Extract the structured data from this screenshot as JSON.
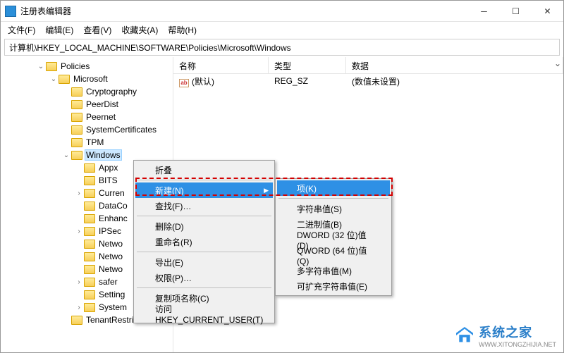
{
  "title": "注册表编辑器",
  "menus": {
    "file": "文件(F)",
    "edit": "编辑(E)",
    "view": "查看(V)",
    "fav": "收藏夹(A)",
    "help": "帮助(H)"
  },
  "address": "计算机\\HKEY_LOCAL_MACHINE\\SOFTWARE\\Policies\\Microsoft\\Windows",
  "cols": {
    "name": "名称",
    "type": "类型",
    "data": "数据"
  },
  "row": {
    "name": "(默认)",
    "type": "REG_SZ",
    "data": "(数值未设置)"
  },
  "tree": [
    {
      "indent": 50,
      "chev": "v",
      "label": "Policies"
    },
    {
      "indent": 68,
      "chev": "v",
      "label": "Microsoft"
    },
    {
      "indent": 86,
      "chev": "",
      "label": "Cryptography"
    },
    {
      "indent": 86,
      "chev": "",
      "label": "PeerDist"
    },
    {
      "indent": 86,
      "chev": "",
      "label": "Peernet"
    },
    {
      "indent": 86,
      "chev": "",
      "label": "SystemCertificates"
    },
    {
      "indent": 86,
      "chev": "",
      "label": "TPM"
    },
    {
      "indent": 86,
      "chev": "v",
      "label": "Windows",
      "selected": true
    },
    {
      "indent": 104,
      "chev": "",
      "label": "Appx"
    },
    {
      "indent": 104,
      "chev": "",
      "label": "BITS"
    },
    {
      "indent": 104,
      "chev": ">",
      "label": "Curren"
    },
    {
      "indent": 104,
      "chev": "",
      "label": "DataCo"
    },
    {
      "indent": 104,
      "chev": "",
      "label": "Enhanc"
    },
    {
      "indent": 104,
      "chev": ">",
      "label": "IPSec"
    },
    {
      "indent": 104,
      "chev": "",
      "label": "Netwo"
    },
    {
      "indent": 104,
      "chev": "",
      "label": "Netwo"
    },
    {
      "indent": 104,
      "chev": "",
      "label": "Netwo"
    },
    {
      "indent": 104,
      "chev": ">",
      "label": "safer"
    },
    {
      "indent": 104,
      "chev": "",
      "label": "Setting"
    },
    {
      "indent": 104,
      "chev": ">",
      "label": "System"
    },
    {
      "indent": 86,
      "chev": "",
      "label": "TenantRestriction"
    }
  ],
  "ctx1": {
    "collapse": "折叠",
    "new": "新建(N)",
    "find": "查找(F)…",
    "delete": "删除(D)",
    "rename": "重命名(R)",
    "export": "导出(E)",
    "perm": "权限(P)…",
    "copykey": "复制项名称(C)",
    "goto": "访问 HKEY_CURRENT_USER(T)"
  },
  "ctx2": {
    "key": "项(K)",
    "string": "字符串值(S)",
    "binary": "二进制值(B)",
    "dword": "DWORD (32 位)值(D)",
    "qword": "QWORD (64 位)值(Q)",
    "multi": "多字符串值(M)",
    "expand": "可扩充字符串值(E)"
  },
  "watermark": {
    "name": "系统之家",
    "url": "WWW.XITONGZHIJIA.NET"
  }
}
